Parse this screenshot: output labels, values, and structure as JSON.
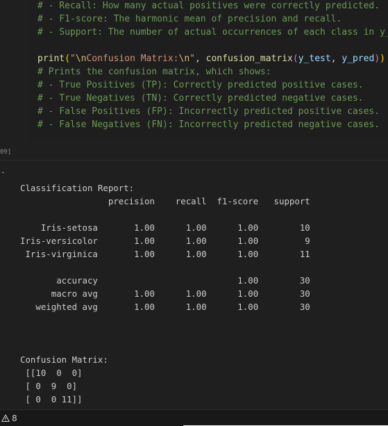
{
  "code": {
    "comment_recall": "# - Recall: How many actual positives were correctly predicted.",
    "comment_f1": "# - F1-score: The harmonic mean of precision and recall.",
    "comment_support": "# - Support: The number of actual occurrences of each class in y_t",
    "print_func": "print",
    "print_open": "(",
    "print_str_q1": "\"",
    "print_str_esc1": "\\n",
    "print_str_body": "Confusion Matrix:",
    "print_str_esc2": "\\n",
    "print_str_q2": "\"",
    "print_comma": ", ",
    "cm_func": "confusion_matrix",
    "cm_open": "(",
    "cm_arg1": "y_test",
    "cm_comma": ", ",
    "cm_arg2": "y_pred",
    "cm_close": ")",
    "print_close": ")",
    "comment_prints": "# Prints the confusion matrix, which shows:",
    "comment_tp": "# - True Positives (TP): Correctly predicted positive cases.",
    "comment_tn": "# - True Negatives (TN): Correctly predicted negative cases.",
    "comment_fp": "# - False Positives (FP): Incorrectly predicted positive cases.",
    "comment_fn": "# - False Negatives (FN): Incorrectly predicted negative cases."
  },
  "cell": {
    "execution_count": "09]",
    "output_marker": "."
  },
  "output": {
    "text": "Classification Report:\n                 precision    recall  f1-score   support\n\n    Iris-setosa       1.00      1.00      1.00        10\nIris-versicolor       1.00      1.00      1.00         9\n Iris-virginica       1.00      1.00      1.00        11\n\n       accuracy                           1.00        30\n      macro avg       1.00      1.00      1.00        30\n   weighted avg       1.00      1.00      1.00        30\n\n\n\nConfusion Matrix:\n [[10  0  0]\n [ 0  9  0]\n [ 0  0 11]]"
  },
  "status_bar": {
    "warning_icon": "warning-icon",
    "warning_count": "8"
  }
}
